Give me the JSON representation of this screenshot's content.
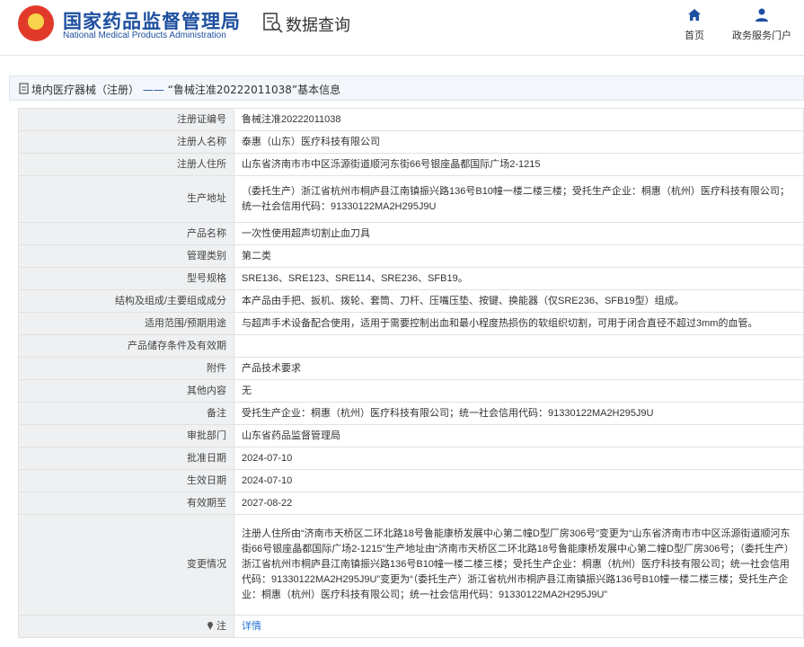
{
  "header": {
    "brand_cn": "国家药品监督管理局",
    "brand_en": "National Medical Products Administration",
    "section_title": "数据查询",
    "nav": {
      "home_label": "首页",
      "portal_label": "政务服务门户"
    }
  },
  "breadcrumb": {
    "category": "境内医疗器械（注册）",
    "separator": "——",
    "record": "“鲁械注准20222011038”基本信息"
  },
  "fields": [
    {
      "key": "注册证编号",
      "value": "鲁械注准20222011038"
    },
    {
      "key": "注册人名称",
      "value": "泰惠（山东）医疗科技有限公司"
    },
    {
      "key": "注册人住所",
      "value": "山东省济南市市中区泺源街道顺河东街66号银座晶都国际广场2-1215"
    },
    {
      "key": "生产地址",
      "value": "（委托生产）浙江省杭州市桐庐县江南镇振兴路136号B10幢一楼二楼三楼；受托生产企业：桐惠（杭州）医疗科技有限公司；统一社会信用代码：91330122MA2H295J9U"
    },
    {
      "key": "产品名称",
      "value": "一次性使用超声切割止血刀具"
    },
    {
      "key": "管理类别",
      "value": "第二类"
    },
    {
      "key": "型号规格",
      "value": "SRE136、SRE123、SRE114、SRE236、SFB19。"
    },
    {
      "key": "结构及组成/主要组成成分",
      "value": "本产品由手把、扳机、拨轮、套筒、刀杆、压嘴压垫、按键、换能器（仅SRE236、SFB19型）组成。"
    },
    {
      "key": "适用范围/预期用途",
      "value": "与超声手术设备配合使用，适用于需要控制出血和最小程度热损伤的软组织切割，可用于闭合直径不超过3mm的血管。"
    },
    {
      "key": "产品储存条件及有效期",
      "value": ""
    },
    {
      "key": "附件",
      "value": "产品技术要求"
    },
    {
      "key": "其他内容",
      "value": "无"
    },
    {
      "key": "备注",
      "value": "受托生产企业：桐惠（杭州）医疗科技有限公司；统一社会信用代码：91330122MA2H295J9U"
    },
    {
      "key": "审批部门",
      "value": "山东省药品监督管理局"
    },
    {
      "key": "批准日期",
      "value": "2024-07-10"
    },
    {
      "key": "生效日期",
      "value": "2024-07-10"
    },
    {
      "key": "有效期至",
      "value": "2027-08-22"
    },
    {
      "key": "变更情况",
      "value": "注册人住所由“济南市天桥区二环北路18号鲁能康桥发展中心第二幢D型厂房306号”变更为“山东省济南市市中区泺源街道顺河东街66号银座晶都国际广场2-1215”生产地址由“济南市天桥区二环北路18号鲁能康桥发展中心第二幢D型厂房306号；（委托生产）浙江省杭州市桐庐县江南镇振兴路136号B10幢一楼二楼三楼；受托生产企业：桐惠（杭州）医疗科技有限公司；统一社会信用代码：91330122MA2H295J9U”变更为“（委托生产）浙江省杭州市桐庐县江南镇振兴路136号B10幢一楼二楼三楼；受托生产企业：桐惠（杭州）医疗科技有限公司；统一社会信用代码：91330122MA2H295J9U”"
    },
    {
      "key": "注",
      "value": "详情"
    }
  ]
}
